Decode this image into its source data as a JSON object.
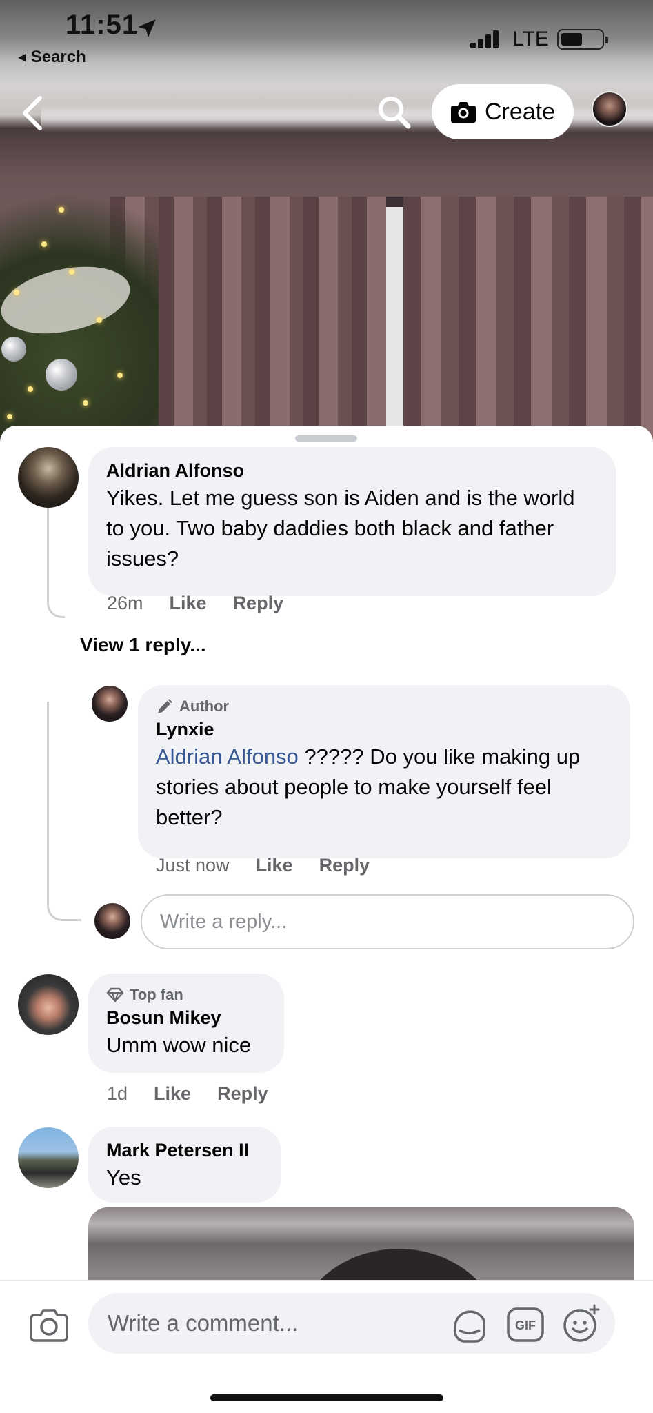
{
  "status_bar": {
    "time": "11:51",
    "back_label": "◂ Search",
    "network": "LTE"
  },
  "nav": {
    "create_label": "Create"
  },
  "comments": [
    {
      "author": "Aldrian Alfonso",
      "text": "Yikes. Let me guess son is Aiden and is the world to you. Two baby daddies both black and father issues?",
      "time": "26m",
      "like": "Like",
      "reply": "Reply",
      "view_replies": "View 1 reply..."
    },
    {
      "badge": "Author",
      "author": "Lynxie",
      "mention": "Aldrian Alfonso",
      "text": " ????? Do you like making up stories about people to make yourself feel better?",
      "time": "Just now",
      "like": "Like",
      "reply": "Reply"
    },
    {
      "badge": "Top fan",
      "author": "Bosun Mikey",
      "text": "Umm wow nice",
      "time": "1d",
      "like": "Like",
      "reply": "Reply"
    },
    {
      "author": "Mark Petersen II",
      "text": "Yes"
    }
  ],
  "reply_input": {
    "placeholder": "Write a reply..."
  },
  "composer": {
    "placeholder": "Write a comment...",
    "icons": [
      "camera-icon",
      "sticker-icon",
      "gif-icon",
      "emoji-icon"
    ]
  },
  "colors": {
    "bubble": "#f0f2f5",
    "meta": "#65676b",
    "mention": "#385898"
  }
}
